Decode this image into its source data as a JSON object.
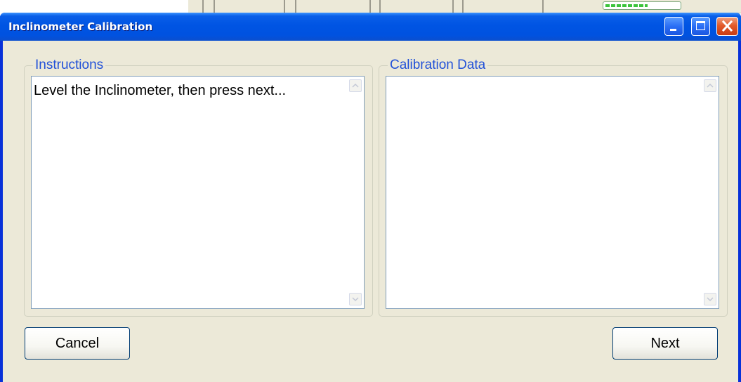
{
  "window": {
    "title": "Inclinometer Calibration"
  },
  "instructions": {
    "label": "Instructions",
    "text": "Level the Inclinometer, then press next..."
  },
  "calibration": {
    "label": "Calibration Data",
    "text": ""
  },
  "buttons": {
    "cancel": "Cancel",
    "next": "Next"
  },
  "icons": {
    "minimize": "minimize-icon",
    "maximize": "maximize-icon",
    "close": "close-icon",
    "scroll_up": "chevron-up-icon",
    "scroll_down": "chevron-down-icon"
  },
  "colors": {
    "titlebar": "#0054e3",
    "client_background": "#ece9d8",
    "group_label": "#2050d8",
    "close_button": "#e25a2a"
  }
}
